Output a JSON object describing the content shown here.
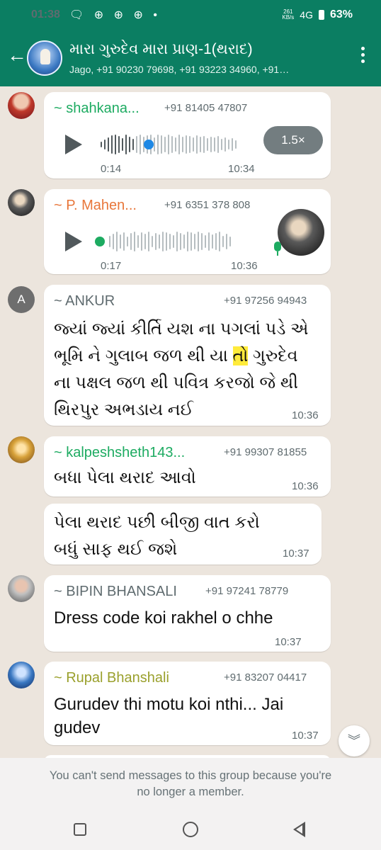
{
  "status_bar": {
    "time": "01:38",
    "notification_icons": "🗨 ⊕ ⊕ ⊕ •",
    "network_top": "261",
    "network_bottom": "KB/s",
    "network": "4G",
    "battery": "63%"
  },
  "header": {
    "title": "મારા ગુરુદેવ મારા પ્રાણ-1(થરાદ)",
    "subtitle": "Jago, +91 90230 79698, +91 93223 34960, +91…"
  },
  "messages": [
    {
      "type": "voice",
      "sender": "~ shahkana...",
      "phone": "+91 81405 47807",
      "duration": "0:14",
      "time": "10:34",
      "speed": "1.5×",
      "progress": 0.3,
      "sender_color": "#1dab61"
    },
    {
      "type": "voice",
      "sender": "~ P. Mahen...",
      "phone": "+91 6351 378 808",
      "duration": "0:17",
      "time": "10:36",
      "progress": 0.0,
      "sender_color": "#e8763a"
    },
    {
      "type": "text",
      "avatar_letter": "A",
      "sender": "~ ANKUR",
      "phone": "+91 97256 94943",
      "lines": [
        "જ્યાં જ્યાં કીર્તિ યશ ના પગલાં પડે એ",
        "ભૂમિ ને ગુલાબ જળ થી યા",
        "તો",
        "ગુરુદેવ",
        "ના પક્ષલ જળ થી પવિત્ર કરજો જે થી",
        "થિરપુર અભડાય નઈ"
      ],
      "time": "10:36",
      "sender_color": "#5f6b6f",
      "highlight_color": "#ffeb3b"
    },
    {
      "type": "text",
      "sender": "~ kalpeshsheth143...",
      "phone": "+91 99307 81855",
      "text": "બધા પેલા થરાદ આવો",
      "time": "10:36",
      "sender_color": "#1dab61"
    },
    {
      "type": "text",
      "lines": [
        "પેલા થરાદ પછી બીજી વાત કરો",
        "બધું સાફ થઈ જશે"
      ],
      "time": "10:37"
    },
    {
      "type": "text",
      "sender": "~ BIPIN BHANSALI",
      "phone": "+91 97241 78779",
      "text": "Dress code koi rakhel o chhe",
      "time": "10:37",
      "sender_color": "#5f6b6f"
    },
    {
      "type": "text",
      "sender": "~ Rupal Bhanshali",
      "phone": "+91 83207 04417",
      "lines": [
        "Gurudev thi motu koi nthi... Jai",
        "gudev"
      ],
      "time": "10:37",
      "sender_color": "#9aa02c"
    }
  ],
  "notice": {
    "line1": "You can't send messages to this group because you're",
    "line2": "no longer a member."
  },
  "colors": {
    "header_bg": "#0b7e62",
    "chat_bg": "#ece5dd",
    "accent_green": "#1dab61"
  },
  "icons": [
    "back-arrow-icon",
    "more-vertical-icon",
    "play-icon",
    "mic-icon",
    "chevron-double-down-icon",
    "nav-recents-icon",
    "nav-home-icon",
    "nav-back-icon"
  ]
}
